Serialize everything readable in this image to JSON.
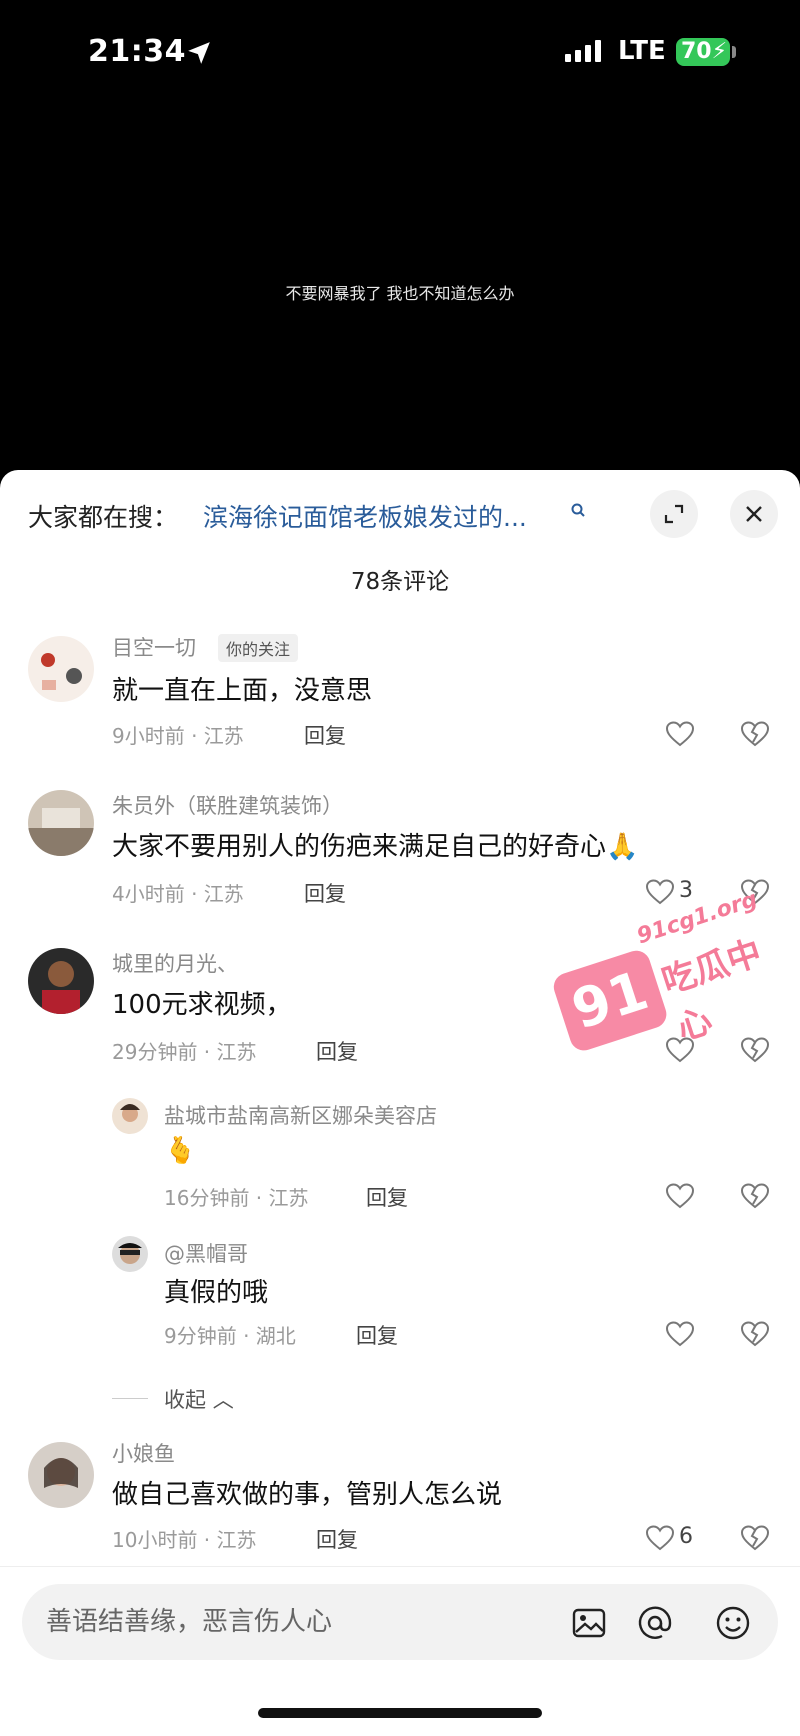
{
  "status_bar": {
    "time": "21:34",
    "network": "LTE",
    "battery": "70"
  },
  "video": {
    "caption": "不要网暴我了 我也不知道怎么办"
  },
  "sheet": {
    "search_prefix": "大家都在搜：",
    "search_link": "滨海徐记面馆老板娘发过的...",
    "comment_count": "78条评论"
  },
  "comments": [
    {
      "name": "目空一切",
      "tag": "你的关注",
      "text": "就一直在上面，没意思",
      "meta": "9小时前 · 江苏",
      "reply": "回复",
      "likes": ""
    },
    {
      "name": "朱员外（联胜建筑装饰）",
      "text": "大家不要用别人的伤疤来满足自己的好奇心🙏",
      "meta": "4小时前 · 江苏",
      "reply": "回复",
      "likes": "3"
    },
    {
      "name": "城里的月光、",
      "text": "100元求视频，",
      "meta": "29分钟前 · 江苏",
      "reply": "回复",
      "likes": ""
    },
    {
      "name": "盐城市盐南高新区娜朵美容店",
      "text": "🫰",
      "meta": "16分钟前 · 江苏",
      "reply": "回复",
      "likes": ""
    },
    {
      "name": "@黑帽哥",
      "text": "真假的哦",
      "meta": "9分钟前 · 湖北",
      "reply": "回复",
      "likes": ""
    },
    {
      "name": "小娘鱼",
      "text": "做自己喜欢做的事，管别人怎么说",
      "meta": "10小时前 · 江苏",
      "reply": "回复",
      "likes": "6"
    }
  ],
  "collapse_label": "收起",
  "watermark": {
    "number": "91",
    "url": "91cg1.org",
    "name": "吃瓜中心"
  },
  "input": {
    "placeholder": "善语结善缘，恶言伤人心"
  },
  "colors": {
    "link": "#2a5c9a",
    "battery": "#34c759",
    "watermark": "#f47b98"
  },
  "icons": [
    "location-arrow-icon",
    "signal-icon",
    "search-icon",
    "expand-icon",
    "close-icon",
    "heart-icon",
    "broken-heart-icon",
    "image-icon",
    "at-icon",
    "emoji-icon"
  ]
}
